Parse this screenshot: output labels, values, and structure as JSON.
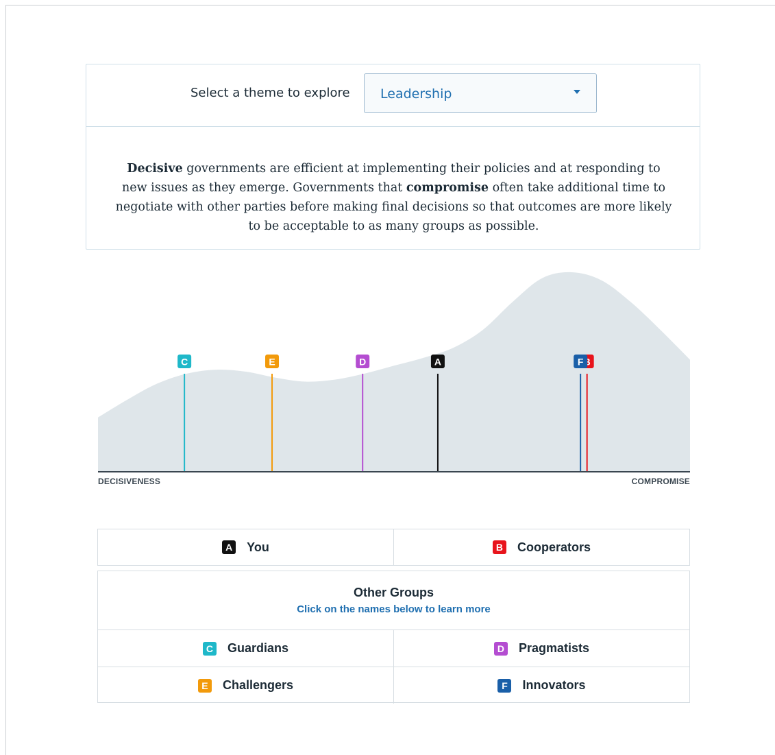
{
  "theme_selector": {
    "label": "Select a theme to explore",
    "selected": "Leadership"
  },
  "description": {
    "term1": "Decisive",
    "part1": " governments are efficient at implementing their policies and at responding to new issues as they emerge. Governments that ",
    "term2": "compromise",
    "part2": " often take additional time to negotiate with other parties before making final decisions so that outcomes are more likely to be acceptable to as many groups as possible."
  },
  "chart_data": {
    "type": "area",
    "xlabel_left": "DECISIVENESS",
    "xlabel_right": "COMPROMISE",
    "xlim": [
      0,
      1
    ],
    "distribution": {
      "x": [
        0,
        0.05,
        0.1,
        0.15,
        0.2,
        0.25,
        0.3,
        0.35,
        0.4,
        0.45,
        0.5,
        0.55,
        0.6,
        0.65,
        0.7,
        0.75,
        0.8,
        0.85,
        0.9,
        0.95,
        1
      ],
      "density": [
        0.27,
        0.36,
        0.44,
        0.49,
        0.51,
        0.5,
        0.47,
        0.45,
        0.46,
        0.49,
        0.53,
        0.57,
        0.62,
        0.71,
        0.85,
        0.97,
        1.0,
        0.96,
        0.85,
        0.71,
        0.56
      ]
    },
    "markers": [
      {
        "letter": "C",
        "position": 0.146,
        "color": "#1fb8c9"
      },
      {
        "letter": "E",
        "position": 0.294,
        "color": "#f29a0b"
      },
      {
        "letter": "D",
        "position": 0.447,
        "color": "#b44dd1"
      },
      {
        "letter": "A",
        "position": 0.574,
        "color": "#111111"
      },
      {
        "letter": "B",
        "position": 0.826,
        "color": "#e8141c"
      },
      {
        "letter": "F",
        "position": 0.815,
        "color": "#1a5fa8"
      }
    ]
  },
  "legend": {
    "you": {
      "letter": "A",
      "label": "You",
      "color": "#111111"
    },
    "party": {
      "letter": "B",
      "label": "Cooperators",
      "color": "#e8141c"
    }
  },
  "other_groups": {
    "title": "Other Groups",
    "subtitle": "Click on the names below to learn more",
    "items": [
      {
        "letter": "C",
        "label": "Guardians",
        "color": "#1fb8c9"
      },
      {
        "letter": "D",
        "label": "Pragmatists",
        "color": "#b44dd1"
      },
      {
        "letter": "E",
        "label": "Challengers",
        "color": "#f29a0b"
      },
      {
        "letter": "F",
        "label": "Innovators",
        "color": "#1a5fa8"
      }
    ]
  }
}
